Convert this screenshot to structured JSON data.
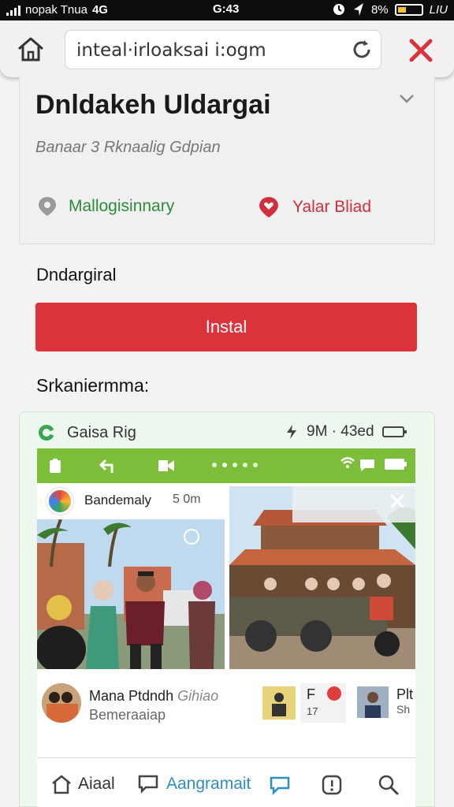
{
  "status_bar": {
    "carrier": "nopak Tnua",
    "network": "4G",
    "time": "G:43",
    "battery_text": "8%",
    "extra": "LIU"
  },
  "url_bar": {
    "url_text": "inteal·irloaksai i:ogm",
    "home_icon": "home-icon",
    "reload_icon": "reload-icon",
    "close_icon": "close-icon"
  },
  "card": {
    "title": "Dnldakeh Uldargai",
    "subtitle": "Banaar 3 Rknaalig Gdpian",
    "location_label": "Mallogisinnary",
    "favorite_label": "Yalar Bliad"
  },
  "section_label": "Dndargiral",
  "install_button": "Instal",
  "screenshots_label": "Srkaniermma:",
  "preview": {
    "app_name": "Gaisa Rig",
    "meta": "9M · 43ed",
    "story_name": "Bandemaly",
    "story_time": "5 0m",
    "post_name": "Mana Ptdndh",
    "post_name_suffix": "Gihiao",
    "post_sub": "Bemeraaiap",
    "thumb2_letter": "F",
    "thumb2_number": "17",
    "thumb4_letter": "Plt",
    "thumb4_number": "Sh"
  },
  "bottom_nav": {
    "item1_label": "Aiaal",
    "item2_label": "Aangramait"
  },
  "colors": {
    "accent_red": "#dc323c",
    "app_green": "#7cbd3a",
    "location_green": "#2f8a3e",
    "nav_blue": "#2c8fc0"
  }
}
